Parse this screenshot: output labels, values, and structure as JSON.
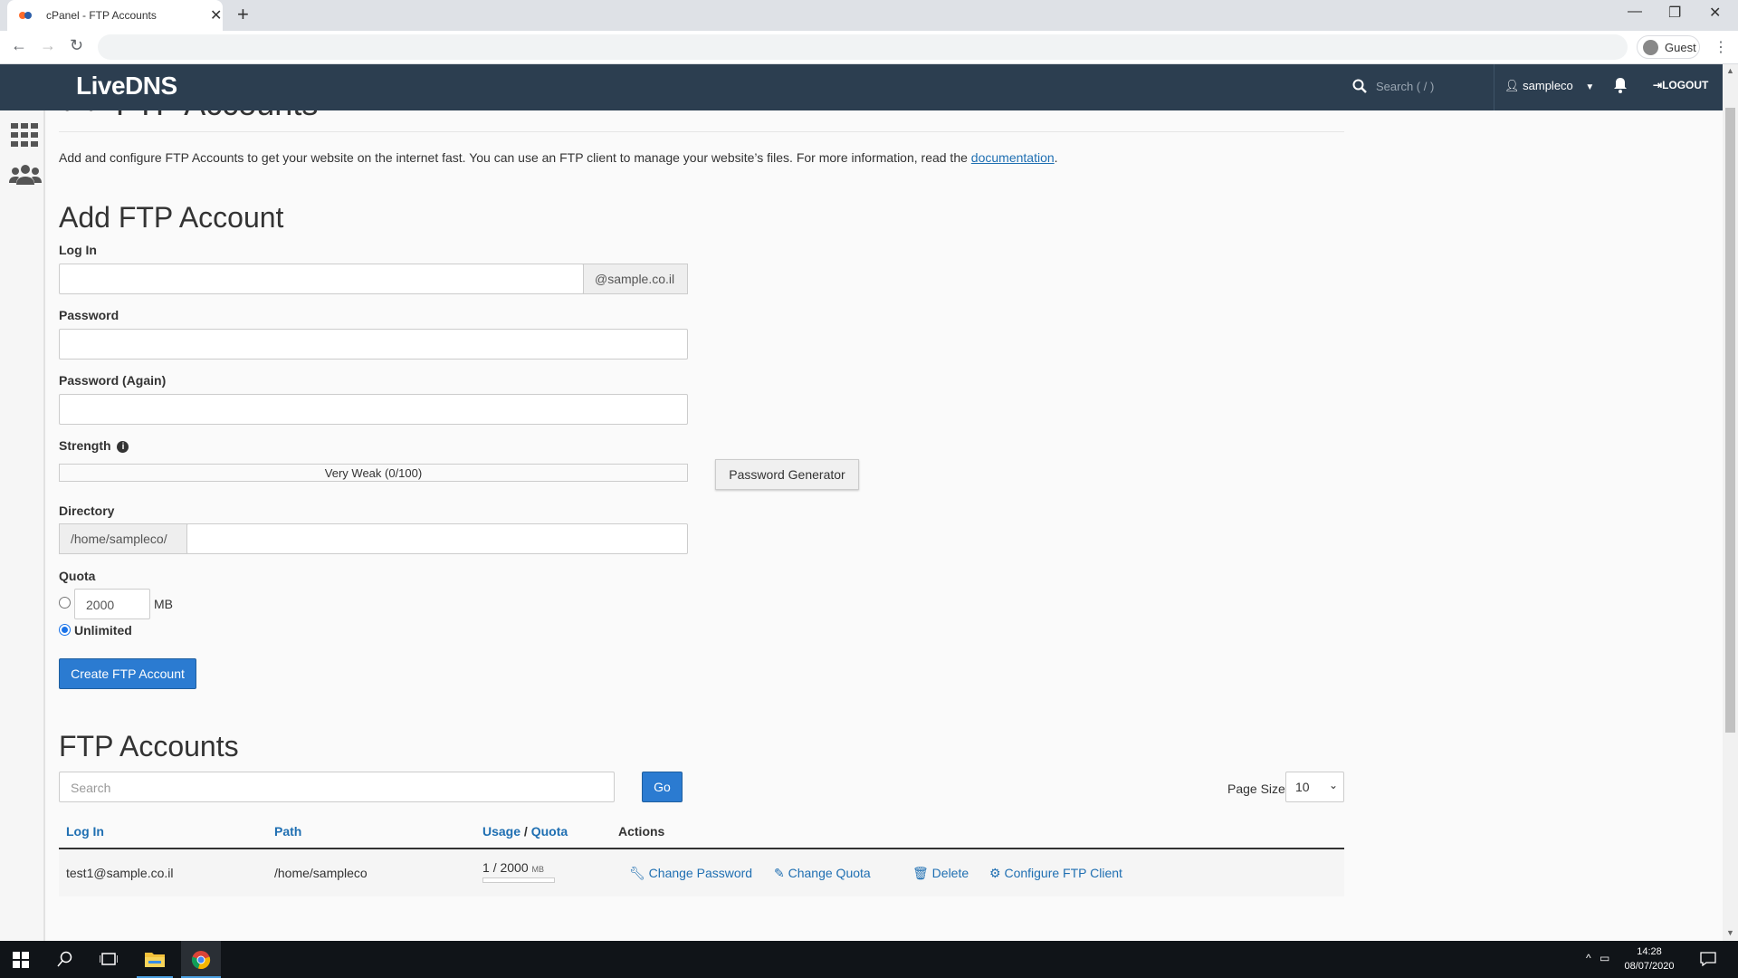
{
  "browser": {
    "tab_title": "cPanel - FTP Accounts",
    "tab_close": "✕",
    "new_tab": "+",
    "profile_label": "Guest"
  },
  "header": {
    "logo": "LiveDNS",
    "search_placeholder": "Search ( / )",
    "username": "sampleco",
    "logout_label": "LOGOUT"
  },
  "page": {
    "title": "FTP Accounts",
    "description_prefix": "Add and configure FTP Accounts to get your website on the internet fast. You can use an FTP client to manage your website’s files. For more information, read the ",
    "description_link": "documentation",
    "description_suffix": "."
  },
  "add_form": {
    "heading": "Add FTP Account",
    "login_label": "Log In",
    "login_value": "",
    "domain_suffix": "@sample.co.il",
    "password_label": "Password",
    "password_again_label": "Password (Again)",
    "strength_label": "Strength",
    "strength_value": "Very Weak (0/100)",
    "strength_score": 0,
    "password_generator_label": "Password Generator",
    "directory_label": "Directory",
    "directory_prefix": "/home/sampleco/",
    "directory_value": "",
    "quota_label": "Quota",
    "quota_value": "2000",
    "quota_unit": "MB",
    "unlimited_label": "Unlimited",
    "unlimited_selected": true,
    "create_label": "Create FTP Account"
  },
  "accounts": {
    "heading": "FTP Accounts",
    "search_placeholder": "Search",
    "go_label": "Go",
    "page_size_label": "Page Size",
    "page_size_value": "10",
    "columns": {
      "login": "Log In",
      "path": "Path",
      "usage": "Usage",
      "slash": "/",
      "quota": "Quota",
      "actions": "Actions"
    },
    "rows": [
      {
        "login": "test1@sample.co.il",
        "path": "/home/sampleco",
        "usage": "1",
        "quota": "2000",
        "unit": "MB",
        "sep": "/",
        "usage_fraction": 0.0005
      }
    ],
    "action_labels": {
      "change_password": "Change Password",
      "change_quota": "Change Quota",
      "delete": "Delete",
      "configure": "Configure FTP Client"
    }
  },
  "taskbar": {
    "time": "14:28",
    "date": "08/07/2020"
  },
  "colors": {
    "header_bg": "#2c3e50",
    "primary_button": "#2b7bd1",
    "link": "#1f6fb2"
  }
}
